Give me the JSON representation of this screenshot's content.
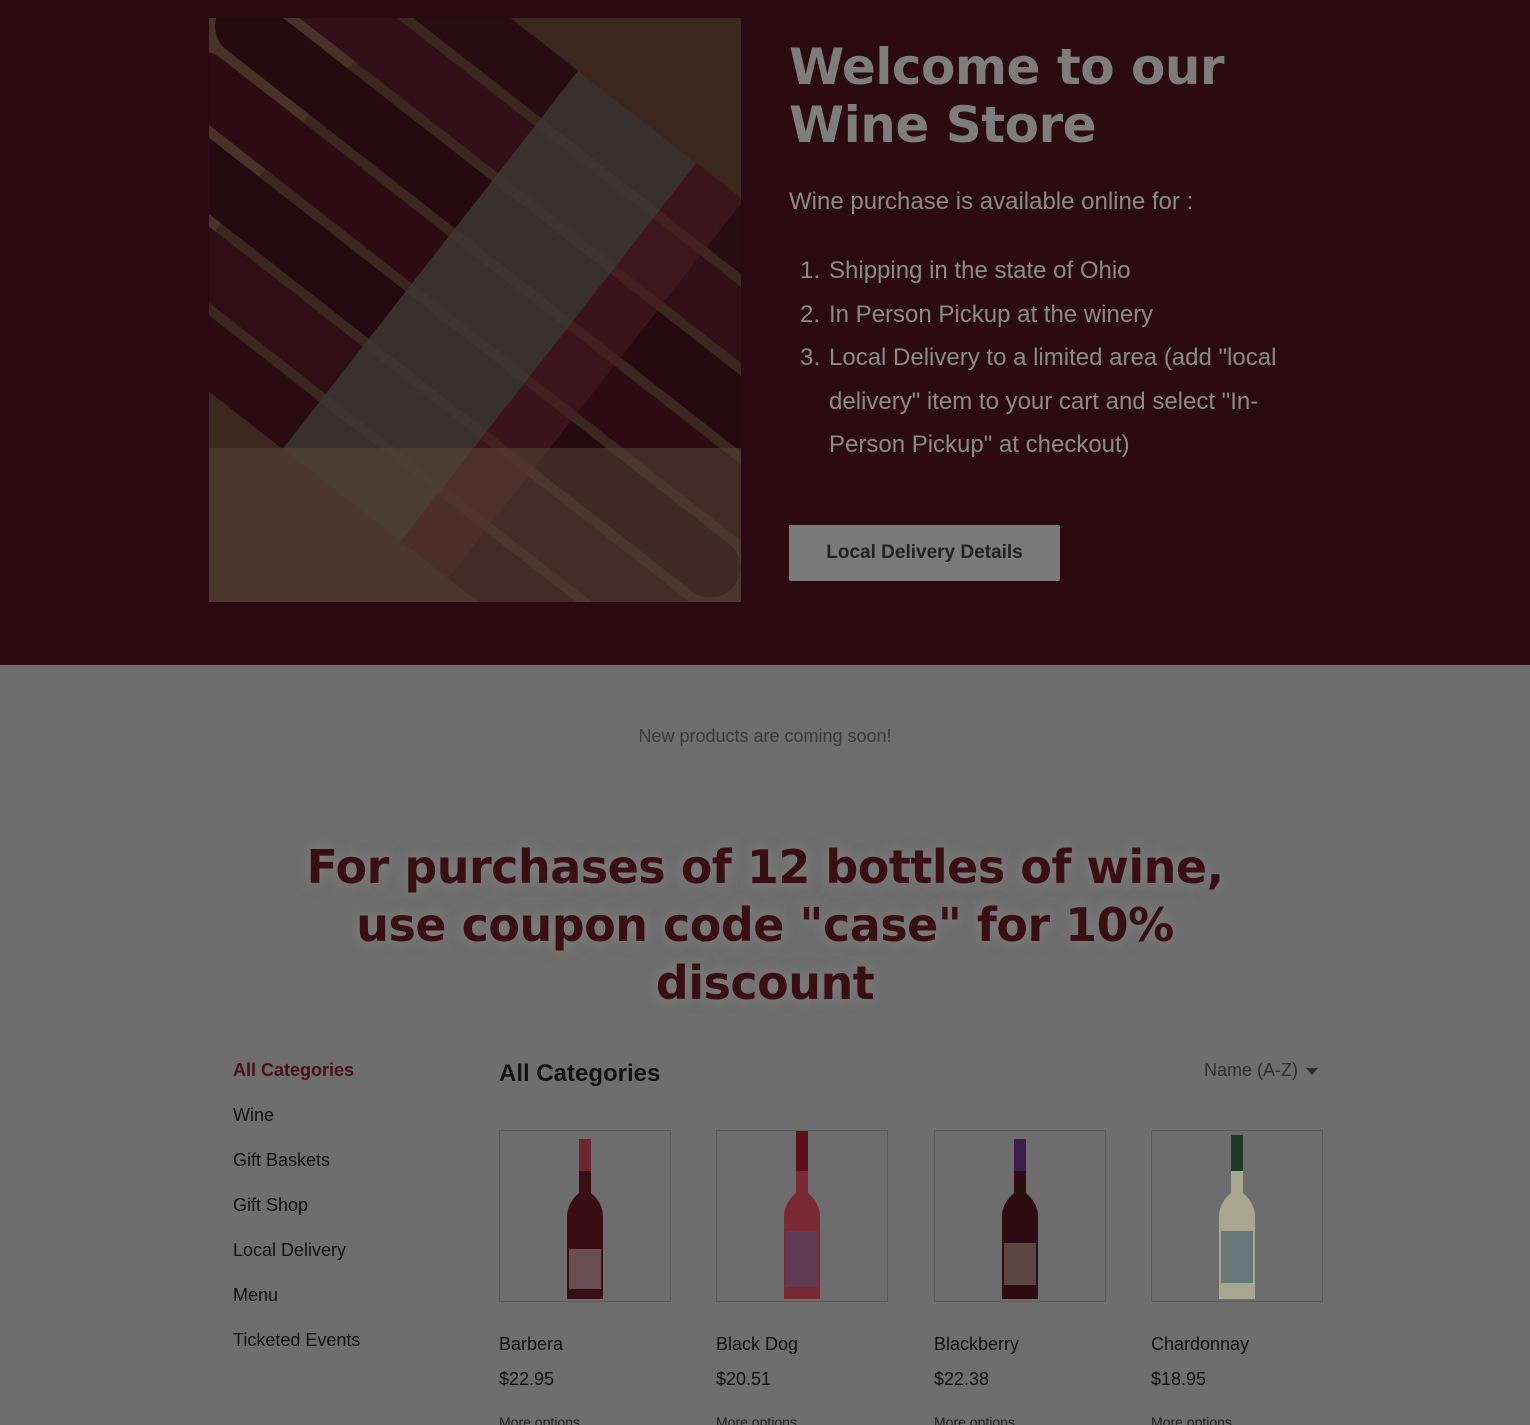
{
  "colors": {
    "hero_background": "#2b0b11",
    "page_overlay": "#6e6e6e",
    "accent_wine": "#4a0f18"
  },
  "hero": {
    "image_icon": "wine-bottles-photo",
    "title": "Welcome to our Wine Store",
    "intro": "Wine purchase is available online for :",
    "options": [
      {
        "num": "1.",
        "text": "Shipping in the state of Ohio"
      },
      {
        "num": "2.",
        "text": "In Person Pickup at the winery"
      },
      {
        "num": "3.",
        "text": "Local Delivery to a limited area (add \"local delivery\" item to your cart and select \"In-Person Pickup\" at checkout)"
      }
    ],
    "button_label": "Local Delivery Details"
  },
  "notice": "New products are coming soon!",
  "promo": "For purchases of 12 bottles of wine, use coupon code \"case\" for 10% discount",
  "categories": {
    "items": [
      {
        "label": "All Categories",
        "active": true
      },
      {
        "label": "Wine"
      },
      {
        "label": "Gift Baskets"
      },
      {
        "label": "Gift Shop"
      },
      {
        "label": "Local Delivery"
      },
      {
        "label": "Menu"
      },
      {
        "label": "Ticketed Events"
      }
    ]
  },
  "store": {
    "title": "All Categories",
    "sort_label": "Name (A-Z)",
    "sort_icon": "caret-down-icon"
  },
  "products": [
    {
      "name": "Barbera",
      "price": "$22.95",
      "more": "More options",
      "bottle_color": "#3a0e16",
      "cap_color": "#6b2630"
    },
    {
      "name": "Black Dog",
      "price": "$20.51",
      "more": "More options",
      "bottle_color": "#7a2a34",
      "cap_color": "#5a1018"
    },
    {
      "name": "Blackberry",
      "price": "$22.38",
      "more": "More options",
      "bottle_color": "#2d0c14",
      "cap_color": "#3a1d4a"
    },
    {
      "name": "Chardonnay",
      "price": "$18.95",
      "more": "More options",
      "bottle_color": "#a8a890",
      "cap_color": "#1e3a2a"
    }
  ]
}
